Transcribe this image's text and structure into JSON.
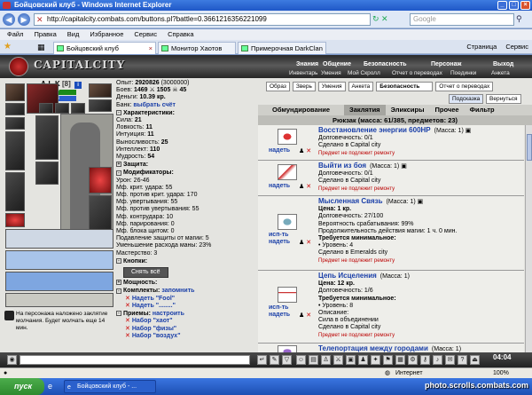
{
  "window": {
    "title": "Бойцовский клуб - Windows Internet Explorer"
  },
  "address": {
    "url": "http://capitalcity.combats.com/buttons.pl?battle=0.3661216356221099",
    "search_placeholder": "Google"
  },
  "menu": [
    "Файл",
    "Правка",
    "Вид",
    "Избранное",
    "Сервис",
    "Справка"
  ],
  "tabs": [
    {
      "label": "Бойцовский клуб"
    },
    {
      "label": "Монитор Хаотов"
    },
    {
      "label": "Примерочная DarkClan"
    }
  ],
  "page_tools": {
    "page": "Страница",
    "tools": "Сервис"
  },
  "game": {
    "logo": "CAPITALCITY",
    "nav_top": [
      "Знания",
      "Общение",
      "Безопасность",
      "Персонаж",
      "Выход"
    ],
    "nav_bottom": [
      "Инвентарь",
      "Умения",
      "Мой Скролл",
      "Отчет о переводах",
      "Поединки",
      "Анкета"
    ],
    "character": {
      "name": "A-L-K",
      "level": "[8]",
      "level_badge": "i",
      "hp": "518/727",
      "mp": "193/193"
    },
    "stats": {
      "exp_label": "Опыт:",
      "exp_value": "2920826",
      "exp_next": "(3000000)",
      "fights_label": "Боев:",
      "fights_value": "1469",
      "wins": "1505",
      "losses": "45",
      "money_label": "Деньги:",
      "money_value": "10.39 кр.",
      "bank_label": "Банк:",
      "bank_link": "выбрать счёт",
      "characteristics_head": "Характеристики:",
      "characteristics": [
        {
          "label": "Сила:",
          "value": "21"
        },
        {
          "label": "Ловкость:",
          "value": "11"
        },
        {
          "label": "Интуиция:",
          "value": "11"
        },
        {
          "label": "Выносливость:",
          "value": "25"
        },
        {
          "label": "Интеллект:",
          "value": "110"
        },
        {
          "label": "Мудрость:",
          "value": "54"
        }
      ],
      "protection_head": "Защита:",
      "modifiers_head": "Модификаторы:",
      "modifiers": [
        "Урон: 26-46",
        "Мф. крит. удара: 55",
        "Мф. против крит. удара: 170",
        "Мф. увертывания: 55",
        "Мф. против увертывания: 55",
        "Мф. контрудара: 10",
        "Мф. парирования: 0",
        "Мф. блока щитом: 0",
        "Подавление защиты от магии: 5",
        "Уменьшение расхода маны: 23%",
        "Мастерство: 3"
      ],
      "buttons_head": "Кнопки:",
      "remove_all": "Снять всё",
      "power_head": "Мощность:",
      "sets_head": "Комплекты:",
      "sets_link": "запомнить",
      "sets": [
        "Надеть \"Fool\"",
        "Надеть \"........\""
      ],
      "techniques_head": "Приемы:",
      "techniques_link": "настроить",
      "techniques": [
        "Набор \"хаот\"",
        "Набор \"физы\"",
        "Набор \"воздух\""
      ]
    },
    "curse_text": "На персонажа наложено заклятие молчания. Будет молчать еще 14 мин.",
    "top_buttons": [
      "Образ",
      "Зверь",
      "Умения",
      "Анкета",
      "Безопасность",
      "Отчет о переводах"
    ],
    "extra_buttons": [
      "Подсказка",
      "Вернуться"
    ],
    "inventory_tabs": [
      "Обмундирование",
      "Заклятия",
      "Эликсиры",
      "Прочее",
      "Фильтр"
    ],
    "backpack_title": "Рюкзак (масса: 61/385, предметов: 23)",
    "items": [
      {
        "action": "надеть",
        "name": "Восстановление энергии 600HP",
        "mass": "(Масса: 1)",
        "lines": [
          "Долговечность: 0/1",
          "Сделано в Capital city"
        ],
        "warn": "Предмет не подлежит ремонту"
      },
      {
        "action": "надеть",
        "name": "Выйти из боя",
        "mass": "(Масса: 1)",
        "lines": [
          "Долговечность: 0/1",
          "Сделано в Capital city"
        ],
        "warn": "Предмет не подлежит ремонту"
      },
      {
        "action": "исп-ть надеть",
        "name": "Мысленная Связь",
        "mass": "(Масса: 1)",
        "price": "Цена: 1 кр.",
        "lines": [
          "Долговечность: 27/100",
          "Вероятность срабатывания: 99%",
          "Продолжительность действия магии: 1 ч. 0 мин."
        ],
        "req_head": "Требуется минимальное:",
        "req": [
          "• Уровень: 4",
          "Сделано в Emeralds city"
        ],
        "warn": "Предмет не подлежит ремонту"
      },
      {
        "action": "исп-ть надеть",
        "name": "Цепь Исцеления",
        "mass": "(Масса: 1)",
        "price": "Цена: 12 кр.",
        "lines": [
          "Долговечность: 1/6"
        ],
        "req_head": "Требуется минимальное:",
        "req": [
          "• Уровень: 8",
          "Описание:",
          "Сила в объединении",
          "Сделано в Capital city"
        ],
        "warn": "Предмет не подлежит ремонту"
      },
      {
        "action": "",
        "name": "Телепортация между городами",
        "mass": "(Масса: 1)",
        "lines": [],
        "warn": ""
      }
    ],
    "clock": "04:04"
  },
  "statusbar": {
    "zone": "Интернет",
    "zoom": "100%"
  },
  "taskbar": {
    "start": "пуск",
    "item": "Бойцовский клуб - ...",
    "watermark": "photo.scrolls.combats.com"
  }
}
